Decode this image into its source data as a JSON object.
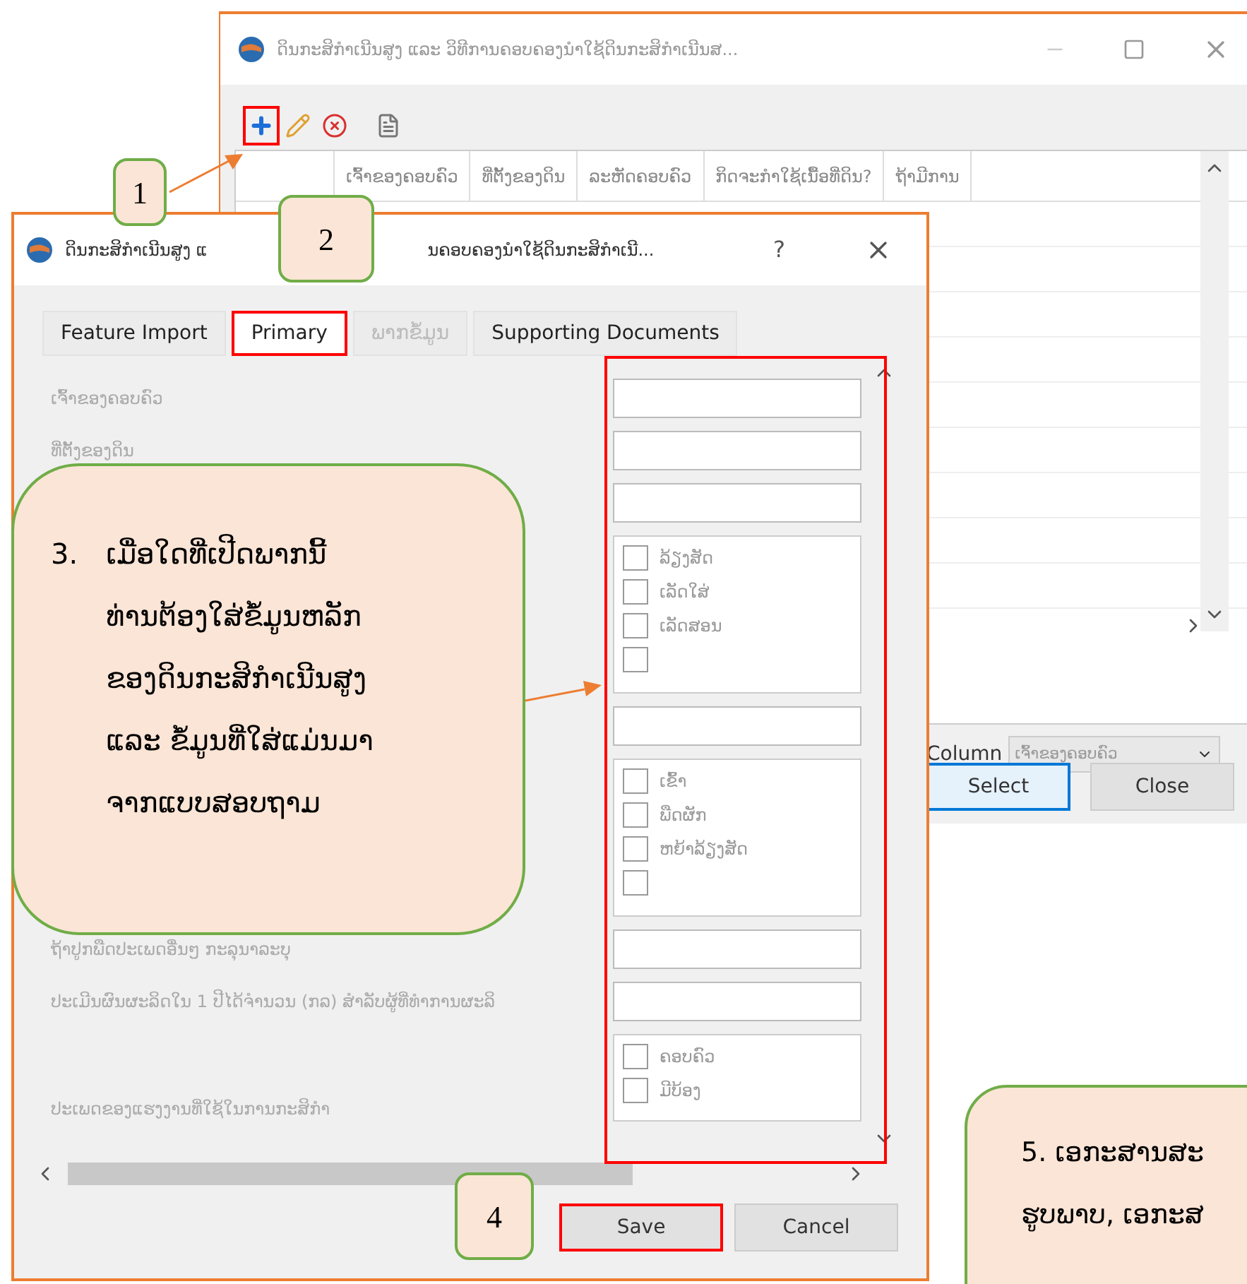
{
  "back_window": {
    "title": "ດິນກະສິກຳເນີນສູງ ແລະ ວິທີການຄອບຄອງນຳໃຊ້ດິນກະສິກຳເນີນສ...",
    "toolbar": [
      {
        "kind": "add",
        "highlighted": true
      },
      {
        "kind": "edit",
        "highlighted": false
      },
      {
        "kind": "delete",
        "highlighted": false
      },
      {
        "kind": "document",
        "highlighted": false
      }
    ],
    "table": {
      "columns": [
        "ເຈົ້າຂອງຄອບຄົວ",
        "ທີ່ຕັ້ງຂອງດິນ",
        "ລະຫັດຄອບຄົວ",
        "ກິດຈະກຳໃຊ້ເນື້ອທີ່ດິນ?",
        "ຖ້າມີການ"
      ]
    },
    "column_label": "Column",
    "column_value": "ເຈົ້າຂອງຄອບຄົວ",
    "buttons": [
      {
        "label": "Select",
        "selected": true
      },
      {
        "label": "Close",
        "selected": false
      }
    ]
  },
  "dialog": {
    "title_start": "ດິນກະສິກຳເນີນສູງ ແ",
    "title_end": "ນຄອບຄອງນຳໃຊ້ດິນກະສິກຳເນີ...",
    "help": "?",
    "tabs": [
      {
        "label": "Feature Import",
        "selected": false,
        "disabled": false,
        "highlighted": false
      },
      {
        "label": "Primary",
        "selected": true,
        "disabled": false,
        "highlighted": true
      },
      {
        "label": "ພາກຂໍ້ມູນ",
        "selected": false,
        "disabled": true,
        "highlighted": false
      },
      {
        "label": "Supporting Documents",
        "selected": false,
        "disabled": false,
        "highlighted": false
      }
    ],
    "rows": [
      {
        "label": "ເຈົ້າຂອງຄອບຄົວ",
        "kind": "text"
      },
      {
        "label": "ທີ່ຕັ້ງຂອງດິນ",
        "kind": "text"
      },
      {
        "kind": "text"
      },
      {
        "kind": "checklist",
        "items": [
          {
            "label": "ລ້ຽງສັດ",
            "checked": false
          },
          {
            "label": "ເລັດໃສ່",
            "checked": false
          },
          {
            "label": "ເລັດສອນ",
            "checked": false
          },
          {
            "checked": false
          }
        ]
      },
      {
        "kind": "text"
      },
      {
        "kind": "checklist",
        "items": [
          {
            "label": "ເຂົ້າ",
            "checked": false
          },
          {
            "label": "ພືດຜັກ",
            "checked": false
          },
          {
            "label": "ຫຍ້າລ້ຽງສັດ",
            "checked": false
          },
          {
            "checked": false
          }
        ]
      },
      {
        "label": "ຖ້າປູກພືດປະເພດອື່ນໆ ກະລຸນາລະບຸ",
        "kind": "text"
      },
      {
        "label": "ປະເມີນຜົນຜະລິດໃນ 1 ປີໄດ້ຈຳນວນ (ກລ) ສຳລັບຜູ້ທີ່ທຳການຜະລິ",
        "kind": "text"
      },
      {
        "label": "ປະເພດຂອງແຮງງານທີ່ໃຊ້ໃນການກະສິກຳ",
        "kind": "checklist",
        "items": [
          {
            "label": "ຄອບຄົວ",
            "checked": false
          },
          {
            "label": "ມີບ້ອງ",
            "checked": false
          }
        ]
      }
    ],
    "buttons": [
      {
        "label": "Save",
        "highlighted": true
      },
      {
        "label": "Cancel",
        "highlighted": false
      }
    ]
  },
  "callouts": [
    {
      "kind": "number",
      "text": "1"
    },
    {
      "kind": "number",
      "text": "2"
    },
    {
      "kind": "note",
      "number": "3.",
      "lines": [
        "ເມື່ອໃດທີ່ເປີດພາກນີ້",
        "ທ່ານຕ້ອງໃສ່ຂໍ້ມູນຫລັກ",
        "ຂອງດິນກະສິກຳເນີນສູງ",
        "ແລະ ຂໍ້ມູນທີ່ໃສ່ແມ່ນມາ",
        "ຈາກແບບສອບຖາມ"
      ]
    },
    {
      "kind": "number",
      "text": "4"
    },
    {
      "kind": "note",
      "lines": [
        "5. ເອກະສານສະ",
        "ຮູບພາບ, ເອກະສ"
      ]
    }
  ]
}
